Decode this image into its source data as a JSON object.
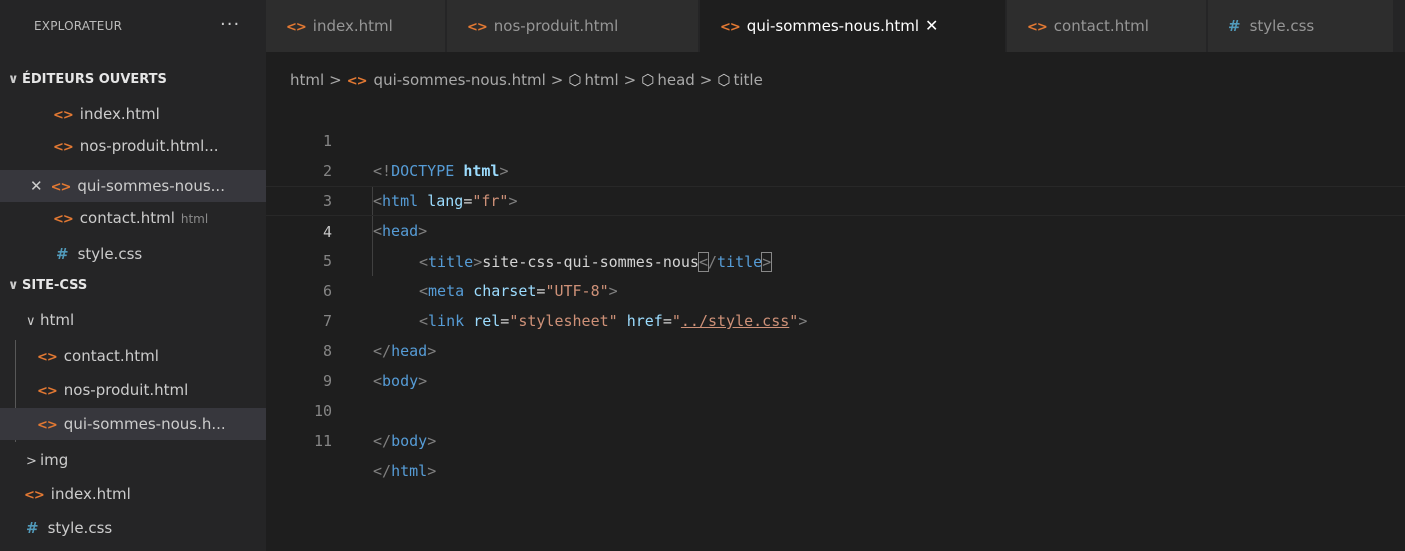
{
  "sidebar": {
    "header": "EXPLORATEUR",
    "more": "···",
    "open_editors_title": "ÉDITEURS OUVERTS",
    "open_editors": [
      {
        "name": "index.html",
        "hint": ""
      },
      {
        "name": "nos-produit.html...",
        "hint": ""
      },
      {
        "name": "qui-sommes-nous...",
        "hint": ""
      },
      {
        "name": "contact.html",
        "hint": "html"
      },
      {
        "name": "style.css",
        "hint": ""
      }
    ],
    "project_title": "SITE-CSS",
    "folder_html": "html",
    "html_files": [
      "contact.html",
      "nos-produit.html",
      "qui-sommes-nous.h..."
    ],
    "folder_img": "img",
    "root_files": [
      "index.html",
      "style.css"
    ]
  },
  "tabs": [
    {
      "label": "index.html"
    },
    {
      "label": "nos-produit.html"
    },
    {
      "label": "qui-sommes-nous.html"
    },
    {
      "label": "contact.html"
    },
    {
      "label": "style.css"
    }
  ],
  "breadcrumb": {
    "items": [
      "html",
      "qui-sommes-nous.html",
      "html",
      "head",
      "title"
    ]
  },
  "code": {
    "line_numbers": [
      "1",
      "2",
      "3",
      "4",
      "5",
      "6",
      "7",
      "8",
      "9",
      "10",
      "11"
    ],
    "doctype_open": "<!",
    "doctype_kw": "DOCTYPE",
    "doctype_html": "html",
    "l2_tag": "html",
    "l2_attr": "lang",
    "l2_val": "\"fr\"",
    "l3_tag": "head",
    "l4_tag": "title",
    "l4_text": "site-css-qui-sommes-nous",
    "l5_tag": "meta",
    "l5_attr": "charset",
    "l5_val": "\"UTF-8\"",
    "l6_tag": "link",
    "l6_attr1": "rel",
    "l6_val1": "\"stylesheet\"",
    "l6_attr2": "href",
    "l6_val2_q": "\"",
    "l6_val2": "../style.css",
    "l7_tag": "head",
    "l8_tag": "body",
    "l10_tag": "body",
    "l11_tag": "html"
  },
  "colors": {
    "tag": "#569cd6",
    "attr": "#9cdcfe",
    "string": "#ce9178",
    "html_icon": "#e37933",
    "css_icon": "#519aba"
  }
}
